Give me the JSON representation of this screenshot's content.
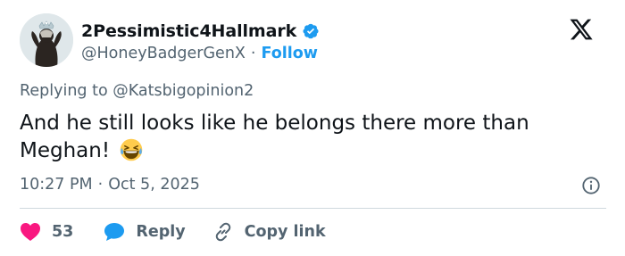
{
  "author": {
    "display_name": "2Pessimistic4Hallmark",
    "handle": "@HoneyBadgerGenX",
    "separator": "·",
    "follow_label": "Follow"
  },
  "replying": {
    "prefix": "Replying to",
    "mention": "@Katsbigopinion2"
  },
  "tweet": {
    "text": "And he still looks like he belongs there more than Meghan!",
    "emoji": "face-with-tears-of-joy"
  },
  "meta": {
    "time": "10:27 PM",
    "separator": "·",
    "date": "Oct 5, 2025"
  },
  "actions": {
    "like_count": "53",
    "reply_label": "Reply",
    "copy_label": "Copy link"
  },
  "colors": {
    "accent": "#1d9bf0",
    "like": "#f91880",
    "text": "#0f1419",
    "secondary": "#536471",
    "divider": "#cfd9de"
  },
  "icons": [
    "verified-badge-icon",
    "x-logo-icon",
    "info-icon",
    "heart-icon",
    "reply-bubble-icon",
    "link-icon",
    "laughing-emoji-icon"
  ]
}
